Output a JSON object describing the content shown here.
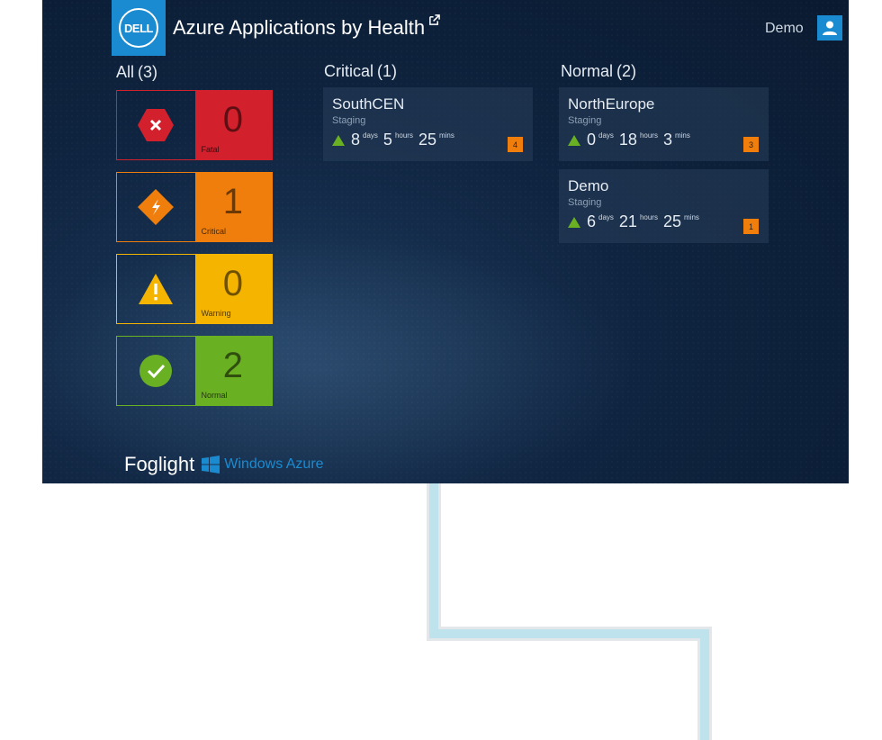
{
  "header": {
    "logo_text": "DELL",
    "title": "Azure Applications by Health",
    "user_name": "Demo"
  },
  "all_column": {
    "label": "All",
    "count": "(3)",
    "tiles": [
      {
        "key": "fatal",
        "value": "0",
        "label": "Fatal",
        "color": "#d2202c"
      },
      {
        "key": "critical",
        "value": "1",
        "label": "Critical",
        "color": "#f07e0c"
      },
      {
        "key": "warning",
        "value": "0",
        "label": "Warning",
        "color": "#f5b400"
      },
      {
        "key": "normal",
        "value": "2",
        "label": "Normal",
        "color": "#6ab023"
      }
    ]
  },
  "critical_column": {
    "label": "Critical",
    "count": "(1)",
    "cards": [
      {
        "name": "SouthCEN",
        "env": "Staging",
        "days": "8",
        "hours": "5",
        "mins": "25",
        "days_unit": "days",
        "hours_unit": "hours",
        "mins_unit": "mins",
        "badge": "4"
      }
    ]
  },
  "normal_column": {
    "label": "Normal",
    "count": "(2)",
    "cards": [
      {
        "name": "NorthEurope",
        "env": "Staging",
        "days": "0",
        "hours": "18",
        "mins": "3",
        "days_unit": "days",
        "hours_unit": "hours",
        "mins_unit": "mins",
        "badge": "3"
      },
      {
        "name": "Demo",
        "env": "Staging",
        "days": "6",
        "hours": "21",
        "mins": "25",
        "days_unit": "days",
        "hours_unit": "hours",
        "mins_unit": "mins",
        "badge": "1"
      }
    ]
  },
  "footer": {
    "product": "Foglight",
    "platform": "Windows Azure"
  },
  "colors": {
    "accent": "#1a8bd0",
    "background": "#0f2440",
    "connector": "#bfe3ec"
  }
}
